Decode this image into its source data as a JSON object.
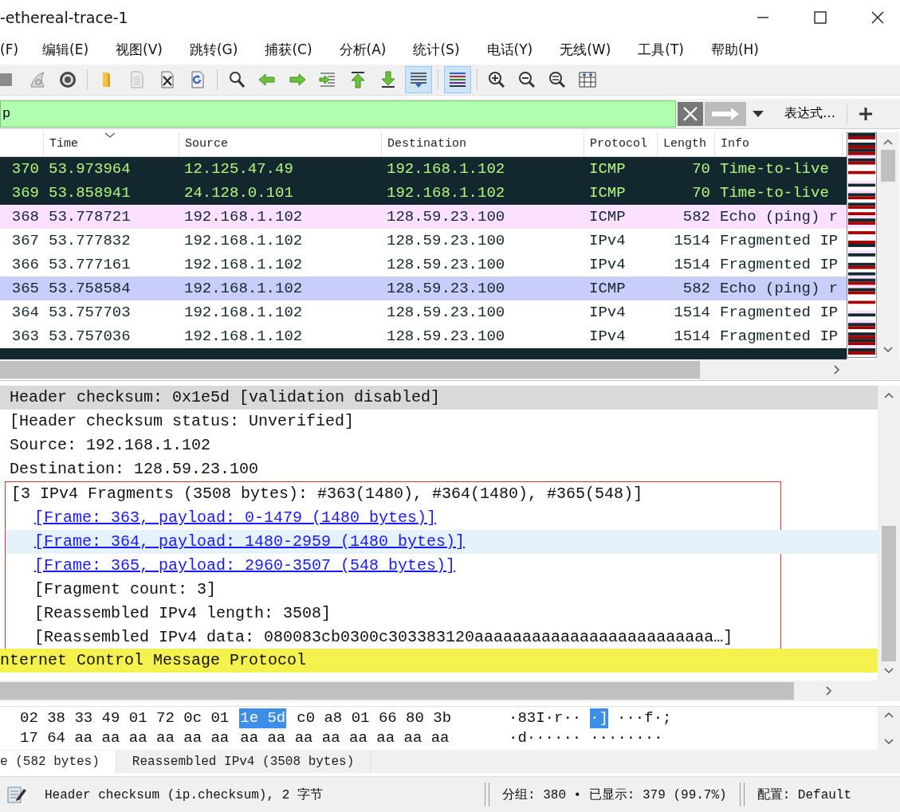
{
  "window": {
    "title": "-ethereal-trace-1"
  },
  "menu": [
    "(F)",
    "编辑(E)",
    "视图(V)",
    "跳转(G)",
    "捕获(C)",
    "分析(A)",
    "统计(S)",
    "电话(Y)",
    "无线(W)",
    "工具(T)",
    "帮助(H)"
  ],
  "toolbar": [
    [
      {
        "kind": "stop",
        "pressed": false
      },
      {
        "kind": "restart",
        "pressed": false
      },
      {
        "kind": "options",
        "pressed": false
      }
    ],
    [
      {
        "kind": "open",
        "pressed": false
      },
      {
        "kind": "file",
        "pressed": false
      },
      {
        "kind": "close-file",
        "pressed": false
      },
      {
        "kind": "reload",
        "pressed": false
      }
    ],
    [
      {
        "kind": "find",
        "pressed": false
      },
      {
        "kind": "back",
        "pressed": false
      },
      {
        "kind": "forward",
        "pressed": false
      },
      {
        "kind": "goto",
        "pressed": false
      },
      {
        "kind": "first",
        "pressed": false
      },
      {
        "kind": "last",
        "pressed": false
      },
      {
        "kind": "autoscroll",
        "pressed": true
      }
    ],
    [
      {
        "kind": "colorize",
        "pressed": true
      }
    ],
    [
      {
        "kind": "zoom-in",
        "pressed": false
      },
      {
        "kind": "zoom-out",
        "pressed": false
      },
      {
        "kind": "zoom-normal",
        "pressed": false
      },
      {
        "kind": "resize-columns",
        "pressed": false
      }
    ]
  ],
  "filter": {
    "value": "p",
    "expression_label": "表达式…"
  },
  "packets": {
    "columns": [
      {
        "label": "Time",
        "sorted": true
      },
      {
        "label": "Source",
        "sorted": false
      },
      {
        "label": "Destination",
        "sorted": false
      },
      {
        "label": "Protocol",
        "sorted": false
      },
      {
        "label": "Length",
        "sorted": false
      },
      {
        "label": "Info",
        "sorted": false
      }
    ],
    "rows": [
      {
        "no": "370",
        "time": "53.973964",
        "source": "12.125.47.49",
        "destination": "192.168.1.102",
        "protocol": "ICMP",
        "length": "70",
        "info": "Time-to-live",
        "kind": "ttl",
        "selected": false
      },
      {
        "no": "369",
        "time": "53.858941",
        "source": "24.128.0.101",
        "destination": "192.168.1.102",
        "protocol": "ICMP",
        "length": "70",
        "info": "Time-to-live",
        "kind": "ttl",
        "selected": false
      },
      {
        "no": "368",
        "time": "53.778721",
        "source": "192.168.1.102",
        "destination": "128.59.23.100",
        "protocol": "ICMP",
        "length": "582",
        "info": "Echo (ping) r",
        "kind": "icmp",
        "selected": false
      },
      {
        "no": "367",
        "time": "53.777832",
        "source": "192.168.1.102",
        "destination": "128.59.23.100",
        "protocol": "IPv4",
        "length": "1514",
        "info": "Fragmented IP",
        "kind": "ipv4",
        "selected": false
      },
      {
        "no": "366",
        "time": "53.777161",
        "source": "192.168.1.102",
        "destination": "128.59.23.100",
        "protocol": "IPv4",
        "length": "1514",
        "info": "Fragmented IP",
        "kind": "ipv4",
        "selected": false
      },
      {
        "no": "365",
        "time": "53.758584",
        "source": "192.168.1.102",
        "destination": "128.59.23.100",
        "protocol": "ICMP",
        "length": "582",
        "info": "Echo (ping) r",
        "kind": "icmp",
        "selected": true
      },
      {
        "no": "364",
        "time": "53.757703",
        "source": "192.168.1.102",
        "destination": "128.59.23.100",
        "protocol": "IPv4",
        "length": "1514",
        "info": "Fragmented IP",
        "kind": "ipv4",
        "selected": false
      },
      {
        "no": "363",
        "time": "53.757036",
        "source": "192.168.1.102",
        "destination": "128.59.23.100",
        "protocol": "IPv4",
        "length": "1514",
        "info": "Fragmented IP",
        "kind": "ipv4",
        "selected": false
      }
    ],
    "cut_row": {
      "kind": "ttl"
    }
  },
  "details": [
    {
      "text": "Header checksum: 0x1e5d [validation disabled]",
      "selected": true,
      "outlined": false
    },
    {
      "text": "[Header checksum status: Unverified]",
      "selected": false,
      "outlined": false
    },
    {
      "text": "Source: 192.168.1.102",
      "selected": false,
      "outlined": false
    },
    {
      "text": "Destination: 128.59.23.100",
      "selected": false,
      "outlined": false
    },
    {
      "text": "[3 IPv4 Fragments (3508 bytes): #363(1480), #364(1480), #365(548)]",
      "selected": false,
      "outlined": true,
      "children": [
        {
          "text": "[Frame: 363, payload: 0-1479 (1480 bytes)]",
          "kind": "link",
          "hovered": false
        },
        {
          "text": "[Frame: 364, payload: 1480-2959 (1480 bytes)]",
          "kind": "link",
          "hovered": true
        },
        {
          "text": "[Frame: 365, payload: 2960-3507 (548 bytes)]",
          "kind": "link",
          "hovered": false
        },
        {
          "text": "[Fragment count: 3]",
          "kind": "plain",
          "hovered": false
        },
        {
          "text": "[Reassembled IPv4 length: 3508]",
          "kind": "plain",
          "hovered": false
        },
        {
          "text": "[Reassembled IPv4 data: 080083cb0300c303383120aaaaaaaaaaaaaaaaaaaaaaaaa…]",
          "kind": "plain",
          "hovered": false
        }
      ]
    }
  ],
  "next_protocol": {
    "text": "nternet Control Message Protocol",
    "highlighted": true
  },
  "hex": [
    {
      "bytes": [
        {
          "text": "02 38 33 49 01 72 0c 01",
          "selected": false
        },
        {
          "text": "1e 5d",
          "selected": true
        },
        {
          "text": "c0 a8 01 66 80 3b",
          "selected": false
        }
      ],
      "ascii": [
        {
          "text": "·83I·r··",
          "selected": false
        },
        {
          "text": "·]",
          "selected": true
        },
        {
          "text": "···f·;",
          "selected": false
        }
      ]
    },
    {
      "bytes": [
        {
          "text": "17 64 aa aa aa aa aa aa",
          "selected": false
        },
        {
          "text": "aa aa aa aa aa aa aa aa",
          "selected": false
        }
      ],
      "ascii": [
        {
          "text": "·d······",
          "selected": false
        },
        {
          "text": "········",
          "selected": false
        }
      ]
    }
  ],
  "byte_tabs": [
    {
      "label": "e (582 bytes)",
      "selected": true
    },
    {
      "label": "Reassembled IPv4 (3508 bytes)",
      "selected": false
    }
  ],
  "status": {
    "field": "Header checksum (ip.checksum), 2 字节",
    "packets": "分组: 380 • 已显示: 379 (99.7%)",
    "profile": "配置: Default"
  }
}
